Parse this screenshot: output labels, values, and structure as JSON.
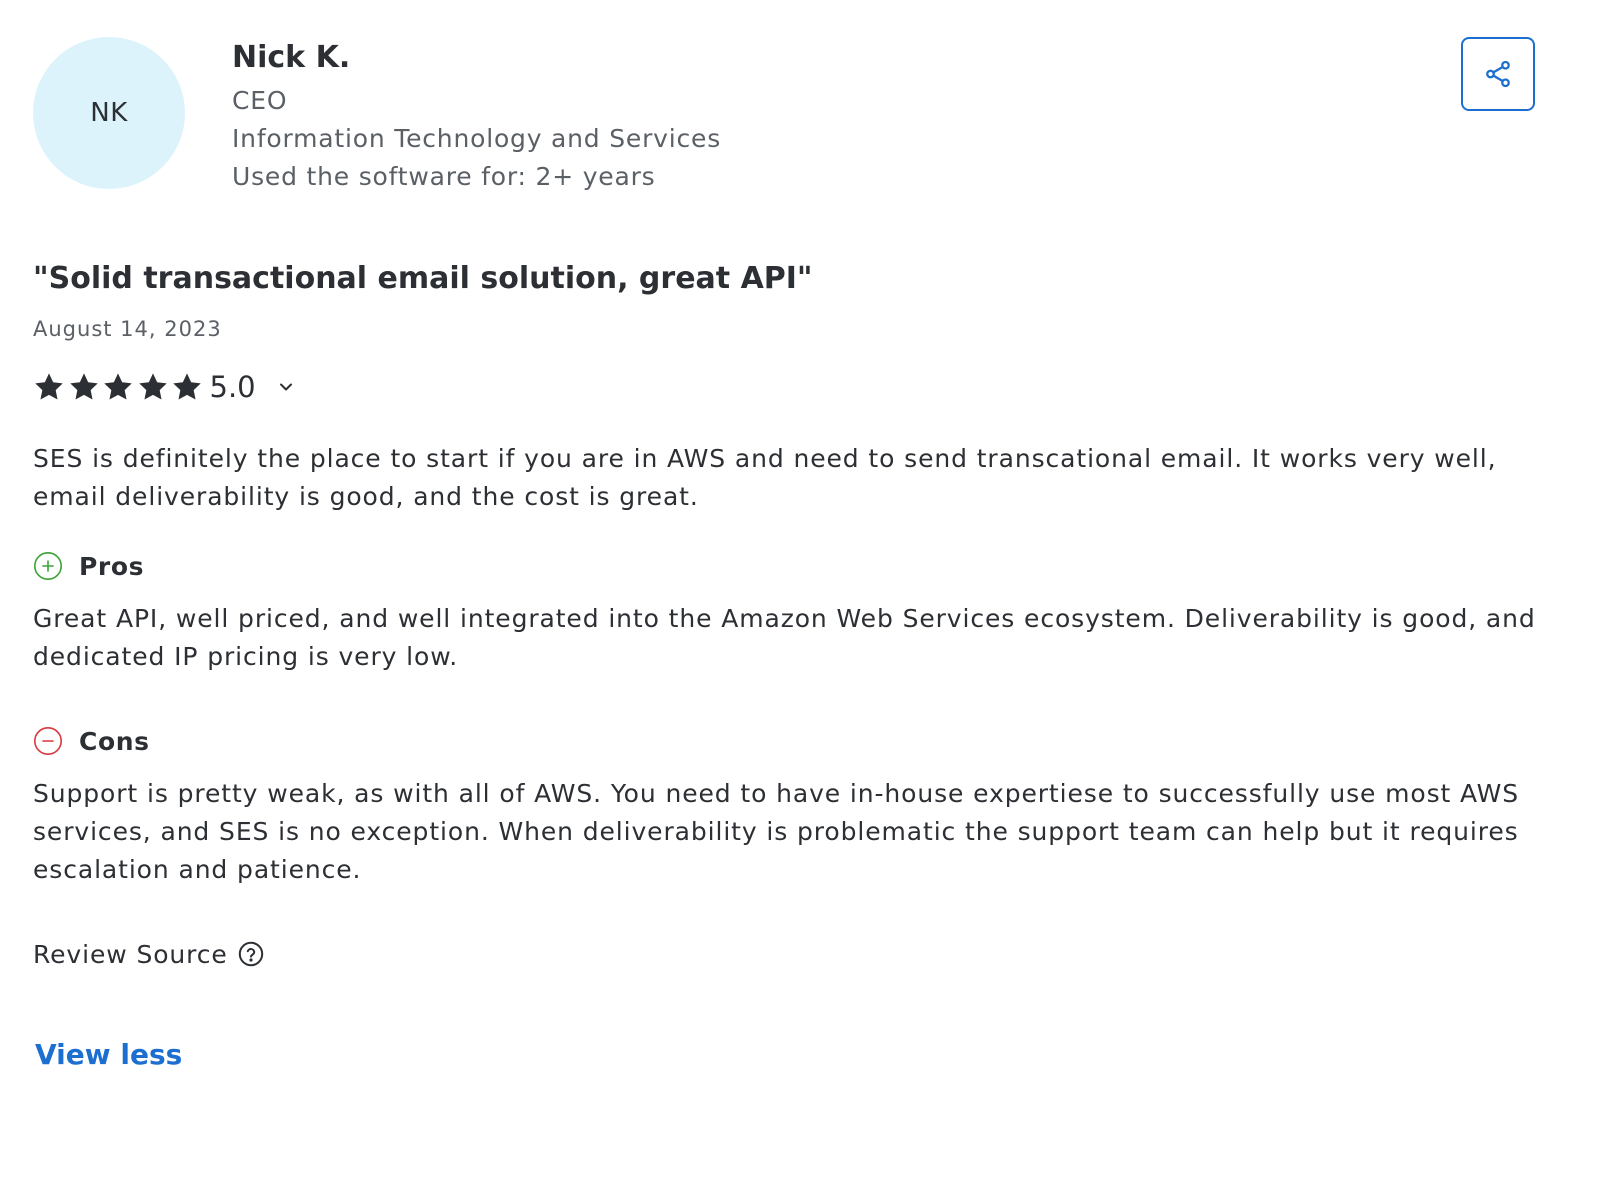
{
  "reviewer": {
    "initials": "NK",
    "name": "Nick K.",
    "role": "CEO",
    "industry": "Information Technology and Services",
    "usage": "Used the software for: 2+ years",
    "avatar_color": "#dcf3fb"
  },
  "share": {
    "icon": "share-icon",
    "color": "#1c6fd1"
  },
  "review": {
    "title": "\"Solid transactional email solution, great API\"",
    "date": "August 14, 2023",
    "rating": {
      "value": "5.0",
      "stars_filled": 5,
      "stars_total": 5,
      "star_color": "#2c2f33",
      "expand_icon": "chevron-down-icon"
    },
    "summary": "SES is definitely the place to start if you are in AWS and need to send transcational email. It works very well, email deliverability is good, and the cost is great.",
    "pros": {
      "label": "Pros",
      "icon": "plus-circle-icon",
      "icon_color": "#3aa335",
      "text": "Great API, well priced, and well integrated into the Amazon Web Services ecosystem. Deliverability is good, and dedicated IP pricing is very low."
    },
    "cons": {
      "label": "Cons",
      "icon": "minus-circle-icon",
      "icon_color": "#d9363e",
      "text": "Support is pretty weak, as with all of AWS. You need to have in-house expertiese to successfully use most AWS services, and SES is no exception. When deliverability is problematic the support team can help but it requires escalation and patience."
    },
    "source": {
      "label": "Review Source",
      "icon": "question-circle-icon"
    }
  },
  "actions": {
    "view_less": "View less",
    "link_color": "#1c6fd1"
  }
}
